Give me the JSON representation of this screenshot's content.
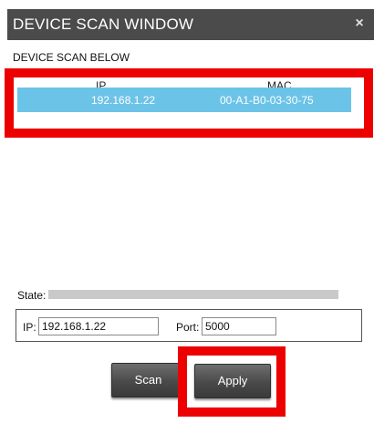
{
  "window": {
    "title": "DEVICE SCAN WINDOW",
    "close_glyph": "×"
  },
  "scan": {
    "subtitle": "DEVICE SCAN BELOW",
    "columns": [
      "IP",
      "MAC"
    ],
    "rows": [
      {
        "ip": "192.168.1.22",
        "mac": "00-A1-B0-03-30-75"
      }
    ]
  },
  "state": {
    "label": "State:"
  },
  "connection": {
    "ip_label": "IP:",
    "ip_value": "192.168.1.22",
    "port_label": "Port:",
    "port_value": "5000"
  },
  "buttons": {
    "scan": "Scan",
    "apply": "Apply"
  },
  "colors": {
    "titlebar": "#4b4b4b",
    "selected_row": "#6cc3e8",
    "highlight": "#ec0000"
  }
}
